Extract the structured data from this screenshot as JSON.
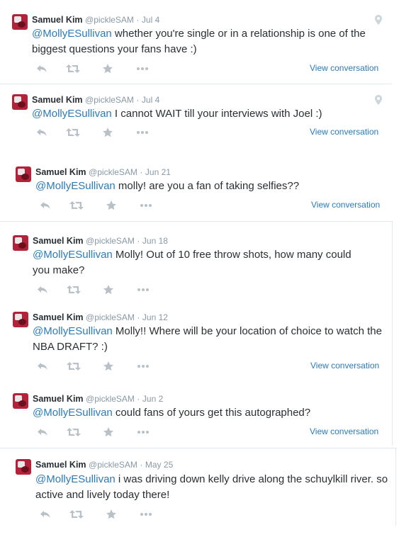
{
  "colors": {
    "link": "#2b7bb9",
    "meta": "#8899a6",
    "icons": "#b8c1c8",
    "divider": "#e1e8ed"
  },
  "tweets": [
    {
      "name": "Samuel Kim",
      "handle": "@pickleSAM",
      "sep": "·",
      "date": "Jul 4",
      "mention": "@MollyESullivan",
      "text": " whether you're single or in a relationship is one of the biggest questions your fans have :)",
      "view": "View conversation",
      "has_location": true
    },
    {
      "name": "Samuel Kim",
      "handle": "@pickleSAM",
      "sep": "·",
      "date": "Jul 4",
      "mention": "@MollyESullivan",
      "text": " I cannot WAIT till your interviews with Joel :)",
      "view": "View conversation",
      "has_location": true
    },
    {
      "name": "Samuel Kim",
      "handle": "@pickleSAM",
      "sep": "·",
      "date": "Jun 21",
      "mention": "@MollyESullivan",
      "text": " molly! are you a fan of taking selfies??",
      "view": "View conversation",
      "has_location": false
    },
    {
      "name": "Samuel Kim",
      "handle": "@pickleSAM",
      "sep": "·",
      "date": "Jun 18",
      "mention": "@MollyESullivan",
      "text": " Molly! Out of 10 free throw shots, how many could you make?",
      "view": "",
      "has_location": false
    },
    {
      "name": "Samuel Kim",
      "handle": "@pickleSAM",
      "sep": "·",
      "date": "Jun 12",
      "mention": "@MollyESullivan",
      "text": " Molly!! Where will be your location of choice to watch the NBA DRAFT? :)",
      "view": "View conversation",
      "has_location": false
    },
    {
      "name": "Samuel Kim",
      "handle": "@pickleSAM",
      "sep": "·",
      "date": "Jun 2",
      "mention": "@MollyESullivan",
      "text": " could fans of yours get this autographed?",
      "view": "View conversation",
      "has_location": false
    },
    {
      "name": "Samuel Kim",
      "handle": "@pickleSAM",
      "sep": "·",
      "date": "May 25",
      "mention": "@MollyESullivan",
      "text": " i was driving down kelly drive along the schuylkill river. so active and lively today there!",
      "view": "",
      "has_location": false
    }
  ]
}
